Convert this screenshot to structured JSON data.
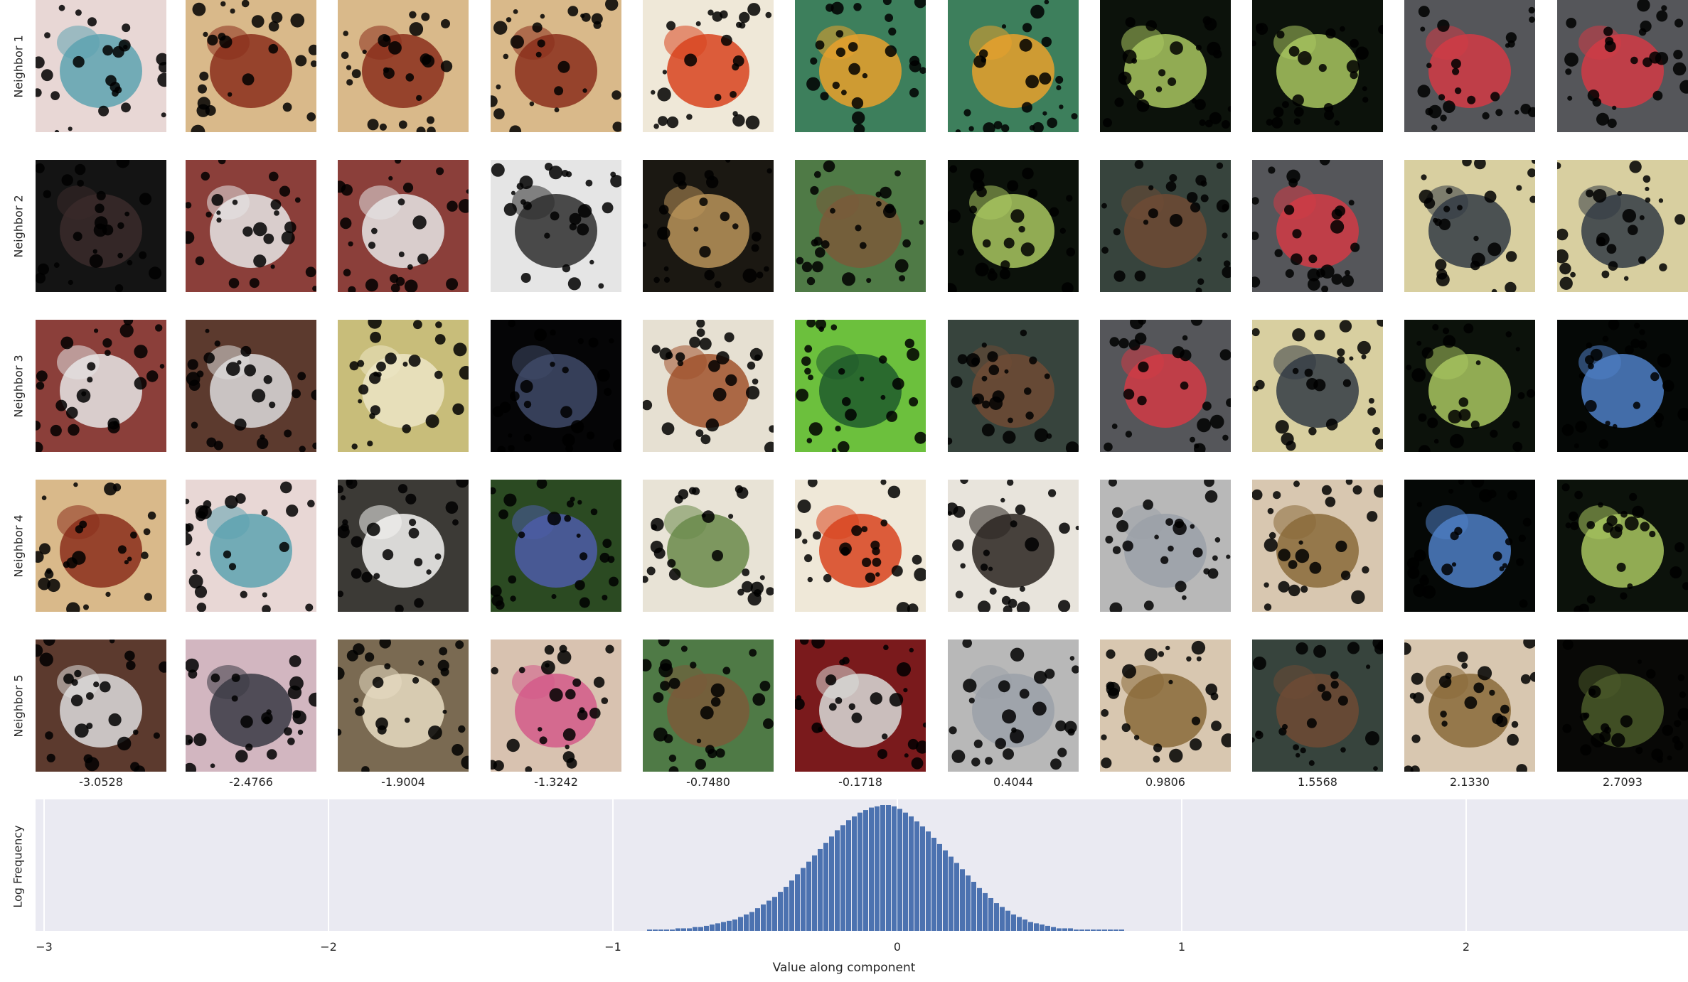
{
  "rows": [
    {
      "label": "Neighbor 1",
      "images": [
        {
          "icon": "glass-window-photo",
          "fg": "#5da3b0",
          "bg": "#e8d7d5"
        },
        {
          "icon": "vacuum-cleaner-photo",
          "fg": "#8a2e1b",
          "bg": "#d9b98a"
        },
        {
          "icon": "vacuum-cleaner-photo",
          "fg": "#8a2e1b",
          "bg": "#d9b98a"
        },
        {
          "icon": "vacuum-cleaner-photo",
          "fg": "#8a2e1b",
          "bg": "#d9b98a"
        },
        {
          "icon": "shirt-tie-photo",
          "fg": "#d8431e",
          "bg": "#efe8d8"
        },
        {
          "icon": "snake-on-leaf-photo",
          "fg": "#e7a02b",
          "bg": "#3d7f5c"
        },
        {
          "icon": "snake-on-leaf-photo",
          "fg": "#e7a02b",
          "bg": "#3d7f5c"
        },
        {
          "icon": "spider-web-photo",
          "fg": "#a9c760",
          "bg": "#0c120b"
        },
        {
          "icon": "spider-web-photo",
          "fg": "#a9c760",
          "bg": "#0c120b"
        },
        {
          "icon": "grey-wall-tag-photo",
          "fg": "#d23a45",
          "bg": "#55565a"
        },
        {
          "icon": "grey-wall-tag-photo",
          "fg": "#d23a45",
          "bg": "#55565a"
        }
      ]
    },
    {
      "label": "Neighbor 2",
      "images": [
        {
          "icon": "dark-dog-photo",
          "fg": "#3a2a2a",
          "bg": "#141414"
        },
        {
          "icon": "shaggy-dog-rug-photo",
          "fg": "#e6e6e6",
          "bg": "#8b3f3a"
        },
        {
          "icon": "shaggy-dog-rug-photo",
          "fg": "#e6e6e6",
          "bg": "#8b3f3a"
        },
        {
          "icon": "dog-in-snow-photo",
          "fg": "#2e2e2e",
          "bg": "#e5e5e5"
        },
        {
          "icon": "wooden-stairs-photo",
          "fg": "#b9945a",
          "bg": "#1b1812"
        },
        {
          "icon": "chickadee-branch-photo",
          "fg": "#7a5a3a",
          "bg": "#4f7a46"
        },
        {
          "icon": "spider-web-photo",
          "fg": "#a9c760",
          "bg": "#0c120b"
        },
        {
          "icon": "stick-on-granite-photo",
          "fg": "#6e4a34",
          "bg": "#37443d"
        },
        {
          "icon": "grey-wall-tag-photo",
          "fg": "#d23a45",
          "bg": "#55565a"
        },
        {
          "icon": "vintage-camper-photo",
          "fg": "#333b44",
          "bg": "#d8cfa0"
        },
        {
          "icon": "vintage-camper-photo",
          "fg": "#333b44",
          "bg": "#d8cfa0"
        }
      ]
    },
    {
      "label": "Neighbor 3",
      "images": [
        {
          "icon": "shaggy-dog-rug-photo",
          "fg": "#e6e6e6",
          "bg": "#8b3f3a"
        },
        {
          "icon": "collie-dog-photo",
          "fg": "#dcdcdc",
          "bg": "#5c3a2e"
        },
        {
          "icon": "hammer-teddy-photo",
          "fg": "#ece5c5",
          "bg": "#c8bd7a"
        },
        {
          "icon": "dark-night-photo",
          "fg": "#3f4a68",
          "bg": "#050506"
        },
        {
          "icon": "staircase-photo",
          "fg": "#a0522d",
          "bg": "#e6e0d2"
        },
        {
          "icon": "green-beetles-photo",
          "fg": "#1f5a2c",
          "bg": "#6cc03d"
        },
        {
          "icon": "stick-on-granite-photo",
          "fg": "#6e4a34",
          "bg": "#37443d"
        },
        {
          "icon": "grey-wall-tag-photo",
          "fg": "#d23a45",
          "bg": "#55565a"
        },
        {
          "icon": "vintage-camper-photo",
          "fg": "#333b44",
          "bg": "#d8cfa0"
        },
        {
          "icon": "spider-web-photo",
          "fg": "#a9c760",
          "bg": "#0c120b"
        },
        {
          "icon": "blue-water-dark-photo",
          "fg": "#4f7fc7",
          "bg": "#050806"
        }
      ]
    },
    {
      "label": "Neighbor 4",
      "images": [
        {
          "icon": "vacuum-cleaner-photo",
          "fg": "#8a2e1b",
          "bg": "#d9b98a"
        },
        {
          "icon": "glass-window-photo",
          "fg": "#5da3b0",
          "bg": "#e8d7d5"
        },
        {
          "icon": "white-dog-photo",
          "fg": "#f4f4f2",
          "bg": "#3c3a36"
        },
        {
          "icon": "flower-bed-photo",
          "fg": "#4d5ca8",
          "bg": "#2b4a22"
        },
        {
          "icon": "food-dumpling-photo",
          "fg": "#6a8a4a",
          "bg": "#e8e3d6"
        },
        {
          "icon": "shirt-tie-photo",
          "fg": "#d8431e",
          "bg": "#efe8d8"
        },
        {
          "icon": "longhorn-beetle-photo",
          "fg": "#2a2420",
          "bg": "#e8e4dc"
        },
        {
          "icon": "manhole-cover-photo",
          "fg": "#9aa0a8",
          "bg": "#b8b8b8"
        },
        {
          "icon": "cricket-insect-photo",
          "fg": "#8a6a3a",
          "bg": "#d8c7b0"
        },
        {
          "icon": "blue-water-dark-photo",
          "fg": "#4f7fc7",
          "bg": "#050806"
        },
        {
          "icon": "spider-web-photo",
          "fg": "#a9c760",
          "bg": "#0c120b"
        }
      ]
    },
    {
      "label": "Neighbor 5",
      "images": [
        {
          "icon": "collie-dog-photo",
          "fg": "#dcdcdc",
          "bg": "#5c3a2e"
        },
        {
          "icon": "panda-toy-photo",
          "fg": "#3a3a44",
          "bg": "#d2b6c0"
        },
        {
          "icon": "dog-on-stairs-photo",
          "fg": "#e8dcc2",
          "bg": "#7a6a52"
        },
        {
          "icon": "flower-pot-photo",
          "fg": "#d45a8a",
          "bg": "#d8c2b0"
        },
        {
          "icon": "chickadee-branch-photo",
          "fg": "#7a5a3a",
          "bg": "#4f7a46"
        },
        {
          "icon": "glass-tumbler-photo",
          "fg": "#d8dcd8",
          "bg": "#7a1a1c"
        },
        {
          "icon": "manhole-cover-photo",
          "fg": "#9aa0a8",
          "bg": "#b8b8b8"
        },
        {
          "icon": "cricket-insect-photo",
          "fg": "#8a6a3a",
          "bg": "#d8c7b0"
        },
        {
          "icon": "stick-on-granite-photo",
          "fg": "#6e4a34",
          "bg": "#37443d"
        },
        {
          "icon": "cricket-insect-photo",
          "fg": "#8a6a3a",
          "bg": "#d8c7b0"
        },
        {
          "icon": "dark-foliage-photo",
          "fg": "#4a5a2a",
          "bg": "#080806"
        }
      ]
    }
  ],
  "column_values": [
    "-3.0528",
    "-2.4766",
    "-1.9004",
    "-1.3242",
    "-0.7480",
    "-0.1718",
    "0.4044",
    "0.9806",
    "1.5568",
    "2.1330",
    "2.7093"
  ],
  "chart_data": {
    "type": "bar",
    "xlabel": "Value along component",
    "ylabel": "Log Frequency",
    "xlim": [
      -3.03,
      2.78
    ],
    "xticks": [
      -3,
      -2,
      -1,
      0,
      1,
      2
    ],
    "xtick_labels": [
      "−3",
      "−2",
      "−1",
      "0",
      "1",
      "2"
    ],
    "grid": true,
    "bar_color": "#4c72b0",
    "panel_color": "#eaeaf2",
    "bin_width": 0.02,
    "bins_x": [
      -0.88,
      -0.86,
      -0.84,
      -0.82,
      -0.8,
      -0.78,
      -0.76,
      -0.74,
      -0.72,
      -0.7,
      -0.68,
      -0.66,
      -0.64,
      -0.62,
      -0.6,
      -0.58,
      -0.56,
      -0.54,
      -0.52,
      -0.5,
      -0.48,
      -0.46,
      -0.44,
      -0.42,
      -0.4,
      -0.38,
      -0.36,
      -0.34,
      -0.32,
      -0.3,
      -0.28,
      -0.26,
      -0.24,
      -0.22,
      -0.2,
      -0.18,
      -0.16,
      -0.14,
      -0.12,
      -0.1,
      -0.08,
      -0.06,
      -0.04,
      -0.02,
      0.0,
      0.02,
      0.04,
      0.06,
      0.08,
      0.1,
      0.12,
      0.14,
      0.16,
      0.18,
      0.2,
      0.22,
      0.24,
      0.26,
      0.28,
      0.3,
      0.32,
      0.34,
      0.36,
      0.38,
      0.4,
      0.42,
      0.44,
      0.46,
      0.48,
      0.5,
      0.52,
      0.54,
      0.56,
      0.58,
      0.6,
      0.62,
      0.64,
      0.66,
      0.68,
      0.7,
      0.72,
      0.74,
      0.76,
      0.78
    ],
    "bins_height": [
      0.01,
      0.01,
      0.01,
      0.01,
      0.01,
      0.02,
      0.02,
      0.02,
      0.03,
      0.03,
      0.04,
      0.05,
      0.06,
      0.07,
      0.08,
      0.09,
      0.11,
      0.13,
      0.15,
      0.18,
      0.21,
      0.24,
      0.27,
      0.31,
      0.35,
      0.4,
      0.45,
      0.5,
      0.55,
      0.6,
      0.65,
      0.7,
      0.75,
      0.8,
      0.84,
      0.88,
      0.91,
      0.94,
      0.96,
      0.98,
      0.99,
      1.0,
      1.0,
      0.99,
      0.97,
      0.94,
      0.91,
      0.87,
      0.83,
      0.79,
      0.74,
      0.69,
      0.64,
      0.59,
      0.54,
      0.49,
      0.44,
      0.39,
      0.34,
      0.3,
      0.26,
      0.22,
      0.19,
      0.16,
      0.13,
      0.11,
      0.09,
      0.07,
      0.06,
      0.05,
      0.04,
      0.03,
      0.02,
      0.02,
      0.02,
      0.01,
      0.01,
      0.01,
      0.01,
      0.01,
      0.01,
      0.01,
      0.01,
      0.01
    ]
  }
}
